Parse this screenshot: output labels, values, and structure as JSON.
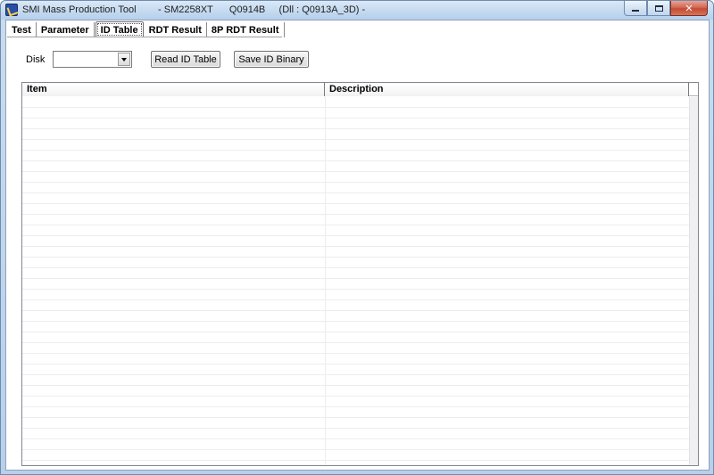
{
  "window": {
    "title": "SMI Mass Production Tool        - SM2258XT      Q0914B     (Dll : Q0913A_3D) -",
    "close_glyph": "✕"
  },
  "tabs": [
    {
      "label": "Test"
    },
    {
      "label": "Parameter"
    },
    {
      "label": "ID Table",
      "active": true
    },
    {
      "label": "RDT Result"
    },
    {
      "label": "8P RDT Result"
    }
  ],
  "toolbar": {
    "disk_label": "Disk",
    "disk_value": "",
    "read_button": "Read ID Table",
    "save_button": "Save ID Binary"
  },
  "table": {
    "columns": [
      "Item",
      "Description"
    ],
    "rows": []
  },
  "icons": {
    "app": "app-logo-icon",
    "minimize": "minimize-icon",
    "maximize": "maximize-icon",
    "close": "close-icon",
    "dropdown": "chevron-down-icon"
  }
}
